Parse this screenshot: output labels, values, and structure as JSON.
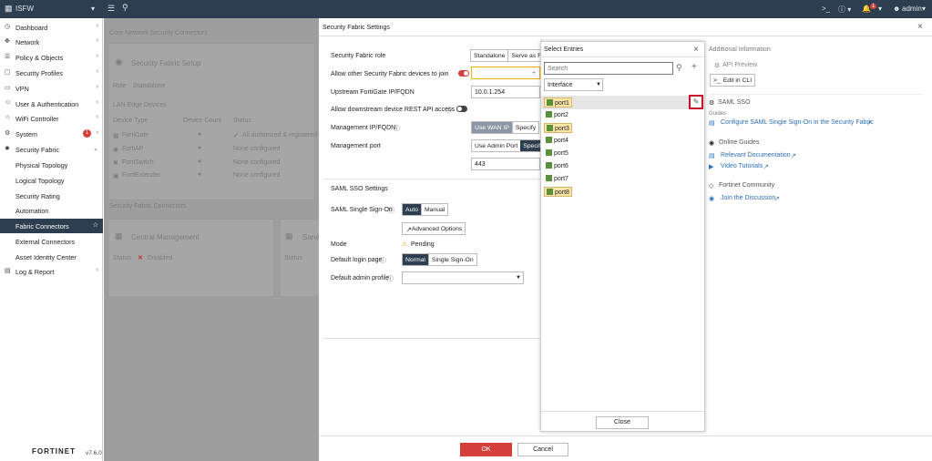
{
  "topbar": {
    "device_name": "ISFW",
    "notif_count": "1",
    "user": "admin"
  },
  "sidebar": {
    "items": [
      {
        "label": "Dashboard",
        "icon": "dashboard-icon"
      },
      {
        "label": "Network",
        "icon": "network-icon"
      },
      {
        "label": "Policy & Objects",
        "icon": "policy-icon"
      },
      {
        "label": "Security Profiles",
        "icon": "lock-icon"
      },
      {
        "label": "VPN",
        "icon": "vpn-icon"
      },
      {
        "label": "User & Authentication",
        "icon": "user-icon"
      },
      {
        "label": "WiFi Controller",
        "icon": "wifi-icon"
      },
      {
        "label": "System",
        "icon": "gear-icon",
        "badge": "1"
      },
      {
        "label": "Security Fabric",
        "icon": "fabric-icon"
      }
    ],
    "sub_items": [
      "Physical Topology",
      "Logical Topology",
      "Security Rating",
      "Automation",
      "Fabric Connectors",
      "External Connectors",
      "Asset Identity Center"
    ],
    "last_item": "Log & Report",
    "brand": "FORTINET",
    "version": "v7.6.0"
  },
  "background": {
    "title": "Core Network Security Connectors",
    "setup": "Security Fabric Setup",
    "role_label": "Role",
    "role_value": "Standalone",
    "lan_edge": "LAN Edge Devices",
    "col_device_type": "Device Type",
    "col_device_count": "Device Count",
    "col_status": "Status",
    "rows": [
      {
        "type": "FortiGate",
        "status": "All authorized & registered"
      },
      {
        "type": "FortiAP",
        "status": "None configured"
      },
      {
        "type": "FortiSwitch",
        "status": "None configured"
      },
      {
        "type": "FortiExtender",
        "status": "None configured"
      }
    ],
    "sf_connectors": "Security Fabric Connectors",
    "central_mgmt": "Central Management",
    "sandbox": "Sand",
    "status_label": "Status",
    "status_disabled": "Disabled",
    "status_label2": "Status"
  },
  "settings": {
    "title": "Security Fabric Settings",
    "role_label": "Security Fabric role",
    "role_opt1": "Standalone",
    "role_opt2": "Serve as Fa",
    "allow_join_label": "Allow other Security Fabric devices to join",
    "upstream_label": "Upstream FortiGate IP/FQDN",
    "upstream_value": "10.0.1.254",
    "allow_rest_label": "Allow downstream device REST API access",
    "mgmt_ip_label": "Management IP/FQDN",
    "mgmt_ip_opt1": "Use WAN IP",
    "mgmt_ip_opt2": "Specify",
    "mgmt_port_label": "Management port",
    "mgmt_port_opt1": "Use Admin Port",
    "mgmt_port_opt2": "Specif",
    "mgmt_port_value": "443",
    "saml_section": "SAML SSO Settings",
    "saml_label": "SAML Single Sign-On",
    "saml_opt1": "Auto",
    "saml_opt2": "Manual",
    "advanced_options": "Advanced Options",
    "mode_label": "Mode",
    "mode_value": "Pending",
    "login_page_label": "Default login page",
    "login_opt1": "Normal",
    "login_opt2": "Single Sign-On",
    "admin_profile_label": "Default admin profile"
  },
  "select_entries": {
    "title": "Select Entries",
    "search_placeholder": "Search",
    "filter_value": "Interface",
    "ports": [
      "port1",
      "port2",
      "port3",
      "port4",
      "port5",
      "port6",
      "port7",
      "port8"
    ],
    "close_label": "Close"
  },
  "info": {
    "title": "Additional Information",
    "api_preview": "API Preview",
    "edit_cli": "Edit in CLI",
    "saml_sso": "SAML SSO",
    "guides": "Guides",
    "configure_saml": "Configure SAML Single Sign-On in the Security Fabric",
    "online_guides": "Online Guides",
    "relevant_docs": "Relevant Documentation",
    "video_tutorials": "Video Tutorials",
    "community": "Fortinet Community",
    "join_discussion": "Join the Discussion"
  },
  "footer": {
    "ok_label": "OK",
    "cancel_label": "Cancel"
  },
  "colors": {
    "nav_dark": "#2d3e50",
    "accent_red": "#d43f3a",
    "highlight_red": "#c8102e",
    "port_green": "#5a8f3c"
  }
}
